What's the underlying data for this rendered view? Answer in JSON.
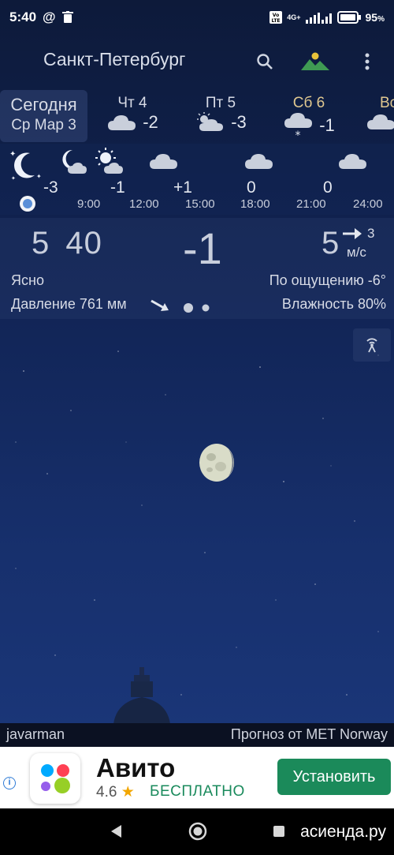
{
  "status_bar": {
    "time": "5:40",
    "battery": "95",
    "battery_unit": "%",
    "network": "4G+",
    "icons": [
      "at-icon",
      "trash-icon",
      "volte-icon",
      "signal-icon",
      "battery-icon"
    ]
  },
  "app_bar": {
    "city": "Санкт-Петербург",
    "icons": [
      "search-icon",
      "landscape-icon",
      "more-icon"
    ]
  },
  "days": [
    {
      "name": "Сегодня",
      "date": "Ср Мар 3"
    },
    {
      "name": "Чт 4",
      "temp": "-2",
      "icon": "cloud-icon"
    },
    {
      "name": "Пт 5",
      "temp": "-3",
      "icon": "sun-cloud-icon"
    },
    {
      "name": "Сб 6",
      "temp": "-1",
      "icon": "snow-cloud-icon"
    },
    {
      "name": "Вс",
      "temp": "",
      "icon": "cloud-icon"
    }
  ],
  "hourly": {
    "temps": [
      "-3",
      "-1",
      "+1",
      "0",
      "0"
    ],
    "times": [
      "9:00",
      "12:00",
      "15:00",
      "18:00",
      "21:00",
      "24:00"
    ],
    "icons": [
      "moon-stars-icon",
      "moon-cloud-icon",
      "sun-cloud-icon",
      "cloud-icon",
      "cloud-icon",
      "cloud-icon"
    ]
  },
  "current": {
    "time": "5 40",
    "temp": "-1",
    "wind_speed": "5",
    "wind_gust": "3",
    "wind_unit": "м/с",
    "condition": "Ясно",
    "feels_like": "По ощущению -6°",
    "pressure": "Давление 761 мм",
    "humidity": "Влажность 80%"
  },
  "footer": {
    "author": "javarman",
    "source": "Прогноз от MET Norway"
  },
  "ad": {
    "title": "Авито",
    "rating": "4.6",
    "price": "БЕСПЛАТНО",
    "install": "Установить"
  },
  "nav": {
    "watermark": "асиенда.ру"
  },
  "colors": {
    "install_button": "#1b8a5a",
    "free_text": "#1a8a5c",
    "sky_top": "#0d1a3a",
    "sky_bottom": "#1c3a80"
  }
}
